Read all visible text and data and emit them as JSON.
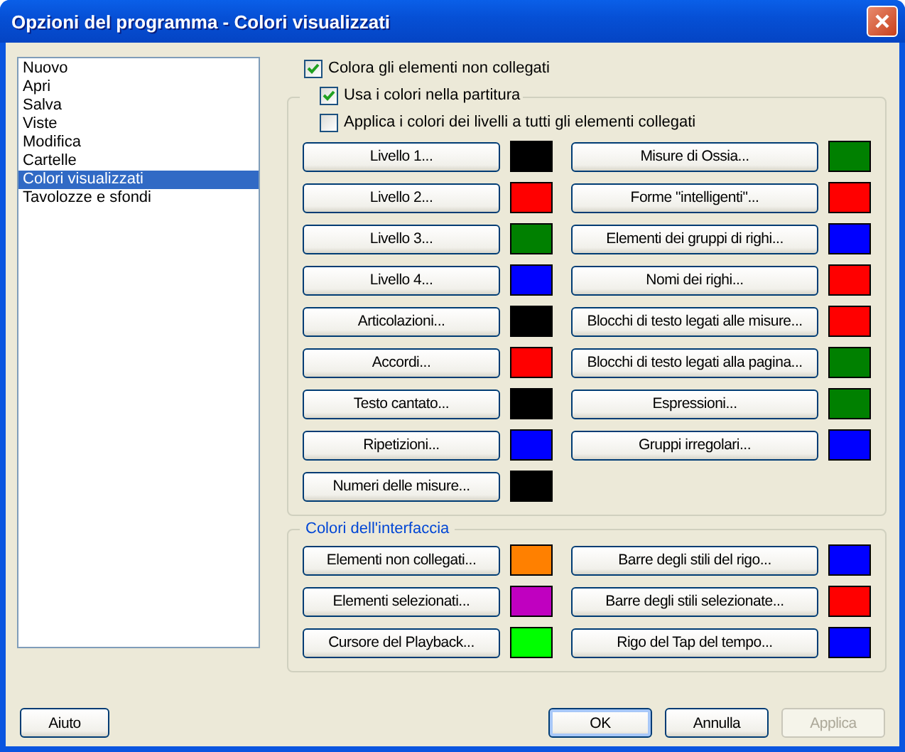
{
  "window": {
    "title": "Opzioni del programma - Colori visualizzati"
  },
  "categories": [
    {
      "label": "Nuovo",
      "selected": false
    },
    {
      "label": "Apri",
      "selected": false
    },
    {
      "label": "Salva",
      "selected": false
    },
    {
      "label": "Viste",
      "selected": false
    },
    {
      "label": "Modifica",
      "selected": false
    },
    {
      "label": "Cartelle",
      "selected": false
    },
    {
      "label": "Colori visualizzati",
      "selected": true
    },
    {
      "label": "Tavolozze e sfondi",
      "selected": false
    }
  ],
  "color_unlinked": {
    "label": "Colora gli elementi non collegati",
    "checked": true
  },
  "score_colors": {
    "use_colors": {
      "label": "Usa i colori nella partitura",
      "checked": true
    },
    "apply_layers": {
      "label": "Applica i colori dei livelli a tutti gli elementi collegati",
      "checked": false
    },
    "columns": [
      [
        {
          "label": "Livello 1...",
          "color": "#000000"
        },
        {
          "label": "Livello 2...",
          "color": "#ff0000"
        },
        {
          "label": "Livello 3...",
          "color": "#008000"
        },
        {
          "label": "Livello 4...",
          "color": "#0000ff"
        },
        {
          "label": "Articolazioni...",
          "color": "#000000"
        },
        {
          "label": "Accordi...",
          "color": "#ff0000"
        },
        {
          "label": "Testo cantato...",
          "color": "#000000"
        },
        {
          "label": "Ripetizioni...",
          "color": "#0000ff"
        },
        {
          "label": "Numeri delle misure...",
          "color": "#000000"
        }
      ],
      [
        {
          "label": "Misure di Ossia...",
          "color": "#008000"
        },
        {
          "label": "Forme \"intelligenti\"...",
          "color": "#ff0000"
        },
        {
          "label": "Elementi dei gruppi di righi...",
          "color": "#0000ff"
        },
        {
          "label": "Nomi dei righi...",
          "color": "#ff0000"
        },
        {
          "label": "Blocchi di testo legati alle misure...",
          "color": "#ff0000"
        },
        {
          "label": "Blocchi di testo legati alla pagina...",
          "color": "#008000"
        },
        {
          "label": "Espressioni...",
          "color": "#008000"
        },
        {
          "label": "Gruppi irregolari...",
          "color": "#0000ff"
        }
      ]
    ]
  },
  "interface_colors": {
    "title": "Colori dell'interfaccia",
    "columns": [
      [
        {
          "label": "Elementi non collegati...",
          "color": "#ff8000"
        },
        {
          "label": "Elementi selezionati...",
          "color": "#c000c0"
        },
        {
          "label": "Cursore del Playback...",
          "color": "#00ff00"
        }
      ],
      [
        {
          "label": "Barre degli stili del rigo...",
          "color": "#0000ff"
        },
        {
          "label": "Barre degli stili selezionate...",
          "color": "#ff0000"
        },
        {
          "label": "Rigo del Tap del tempo...",
          "color": "#0000ff"
        }
      ]
    ]
  },
  "help_button": {
    "label": "Aiuto"
  },
  "actions": [
    {
      "label": "OK",
      "default": true,
      "disabled": false
    },
    {
      "label": "Annulla",
      "default": false,
      "disabled": false
    },
    {
      "label": "Applica",
      "default": false,
      "disabled": true
    }
  ]
}
